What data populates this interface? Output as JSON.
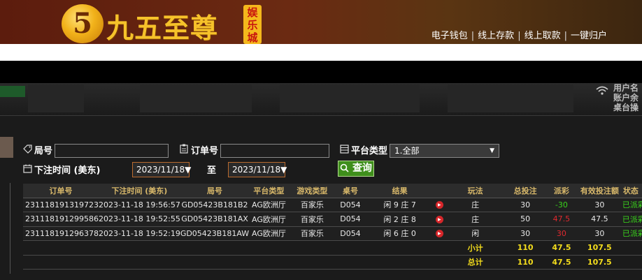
{
  "brand": {
    "logo_glyph": "5",
    "name": "九五至尊",
    "badge": "娱乐城"
  },
  "topnav": {
    "items": [
      "电子钱包",
      "线上存款",
      "线上取款",
      "一键归户"
    ],
    "separator": "|"
  },
  "side_panel": {
    "lines": [
      "用户名",
      "账户余",
      "桌台操"
    ]
  },
  "filters": {
    "order_round_label": "局号",
    "order_no_label": "订单号",
    "platform_label": "平台类型",
    "platform_value": "1.全部",
    "time_label": "下注时间 (美东)",
    "date_from": "2023/11/18",
    "to_label": "至",
    "date_to": "2023/11/18",
    "search_button": "查询"
  },
  "table": {
    "headers": [
      "订单号",
      "下注时间 (美东)",
      "局号",
      "平台类型",
      "游戏类型",
      "桌号",
      "结果",
      "",
      "玩法",
      "总投注",
      "派彩",
      "有效投注额",
      "状态"
    ],
    "rows": [
      {
        "order": "231118191319723",
        "time": "2023-11-18 19:56:57",
        "round": "GD05423B181B2",
        "platform": "AG欧洲厅",
        "game": "百家乐",
        "table": "D054",
        "result": "闲 9 庄 7",
        "play": "庄",
        "bet": "30",
        "payout": "-30",
        "valid": "30",
        "status": "已派彩"
      },
      {
        "order": "231118191299586",
        "time": "2023-11-18 19:52:55",
        "round": "GD05423B181AX",
        "platform": "AG欧洲厅",
        "game": "百家乐",
        "table": "D054",
        "result": "闲 2 庄 8",
        "play": "庄",
        "bet": "50",
        "payout": "47.5",
        "valid": "47.5",
        "status": "已派彩"
      },
      {
        "order": "231118191296378",
        "time": "2023-11-18 19:52:19",
        "round": "GD05423B181AW",
        "platform": "AG欧洲厅",
        "game": "百家乐",
        "table": "D054",
        "result": "闲 6 庄 0",
        "play": "闲",
        "bet": "30",
        "payout": "30",
        "valid": "30",
        "status": "已派彩"
      }
    ],
    "subtotal": {
      "label": "小计",
      "bet": "110",
      "payout": "47.5",
      "valid": "107.5"
    },
    "total": {
      "label": "总计",
      "bet": "110",
      "payout": "47.5",
      "valid": "107.5"
    }
  },
  "colors": {
    "accent_gold": "#f6c22a",
    "win_green": "#39d31b",
    "loss_red": "#e0292f",
    "sum_yellow": "#f3dc1c",
    "search_green": "#3f8f1c"
  }
}
